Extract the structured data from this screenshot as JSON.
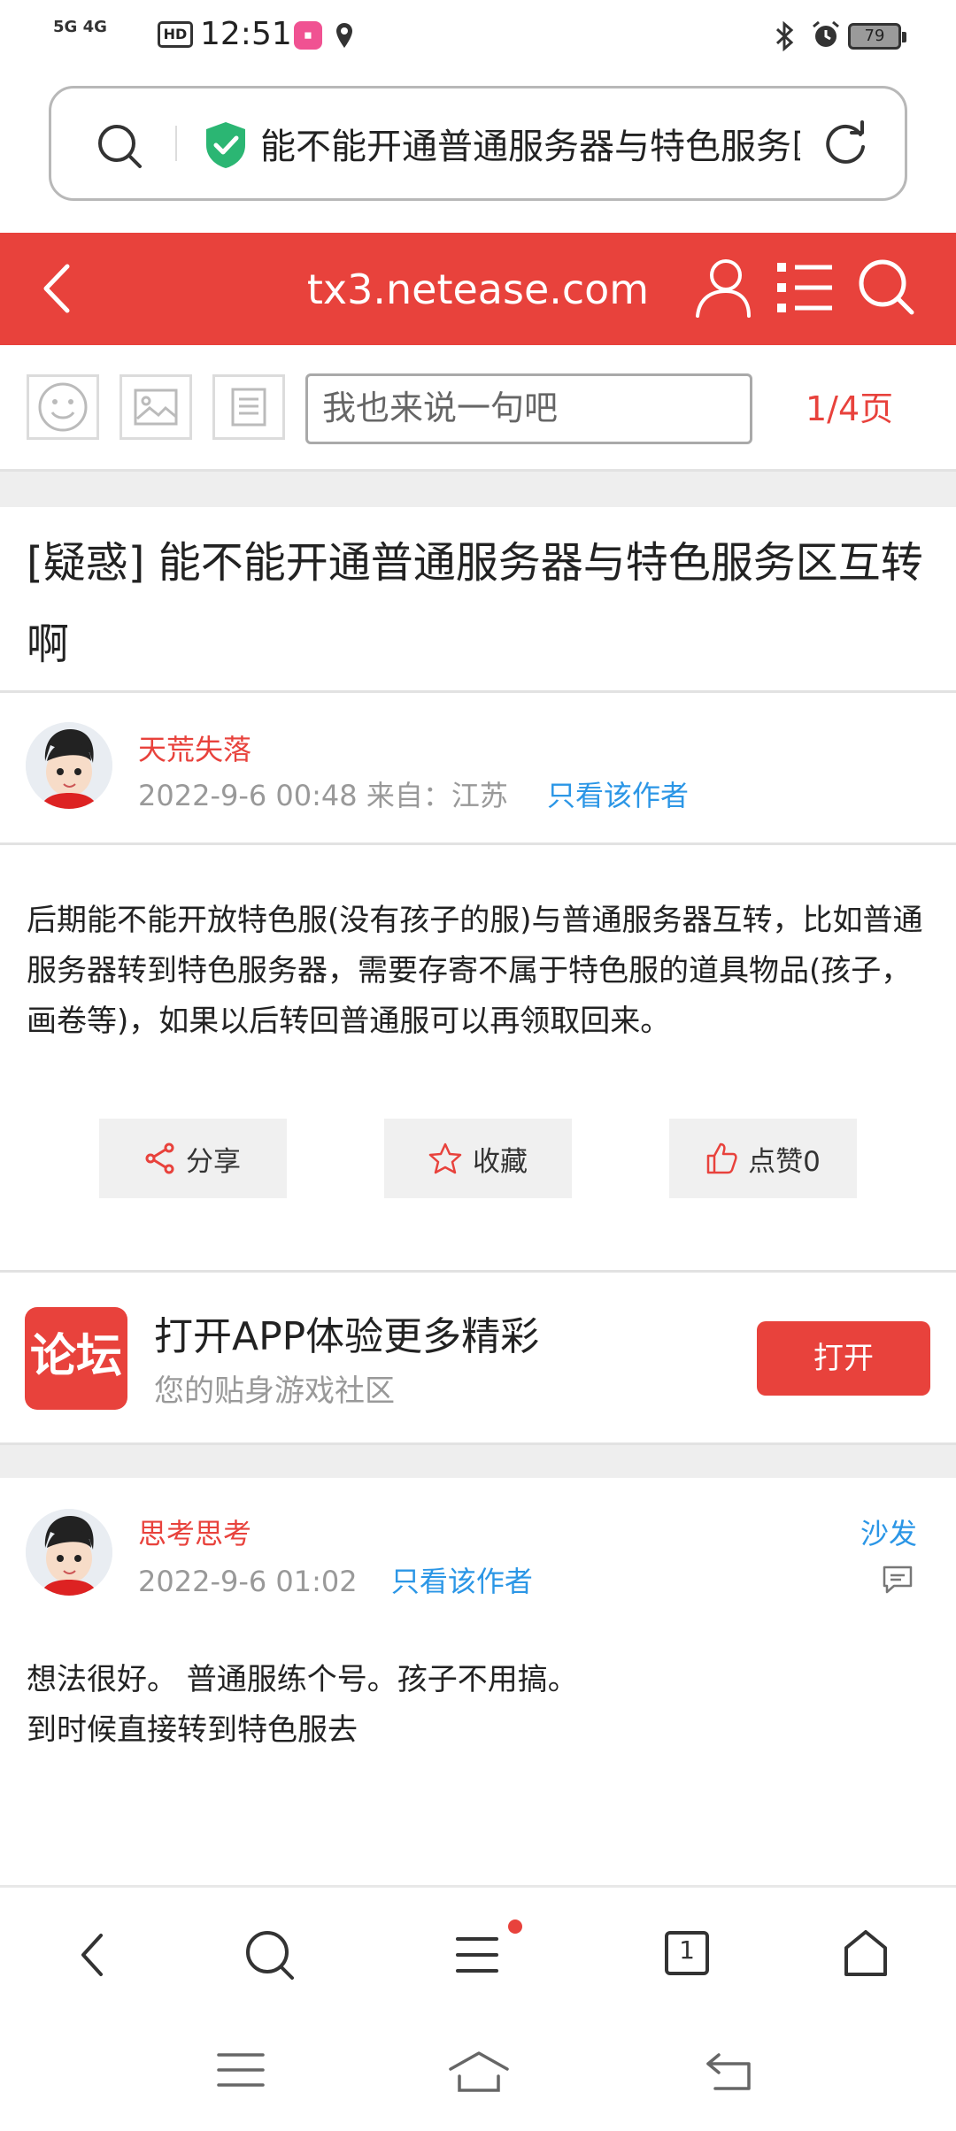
{
  "status_bar": {
    "network": "5G 4G",
    "hd": "HD",
    "time": "12:51",
    "battery": "79"
  },
  "address_bar": {
    "text": "能不能开通普通服务器与特色服务区互转啊"
  },
  "header": {
    "title": "tx3.netease.com"
  },
  "compose": {
    "placeholder": "我也来说一句吧",
    "page_indicator": "1/4页"
  },
  "post": {
    "title": "[疑惑] 能不能开通普通服务器与特色服务区互转啊",
    "author": "天荒失落",
    "meta": "2022-9-6 00:48 来自：江苏",
    "author_only": "只看该作者",
    "content": "后期能不能开放特色服(没有孩子的服)与普通服务器互转，比如普通服务器转到特色服务器，需要存寄不属于特色服的道具物品(孩子，画卷等)，如果以后转回普通服可以再领取回来。",
    "actions": {
      "share": "分享",
      "favorite": "收藏",
      "like": "点赞0"
    }
  },
  "promo": {
    "logo_text": "论坛",
    "title": "打开APP体验更多精彩",
    "subtitle": "您的贴身游戏社区",
    "button": "打开"
  },
  "reply": {
    "author": "思考思考",
    "meta": "2022-9-6 01:02",
    "author_only": "只看该作者",
    "tag": "沙发",
    "lines": [
      "想法很好。 普通服练个号。孩子不用搞。",
      "到时候直接转到特色服去"
    ]
  },
  "bottom_bar": {
    "tabs_count": "1"
  },
  "colors": {
    "brand_red": "#e8423c",
    "link_blue": "#2b96e6"
  }
}
